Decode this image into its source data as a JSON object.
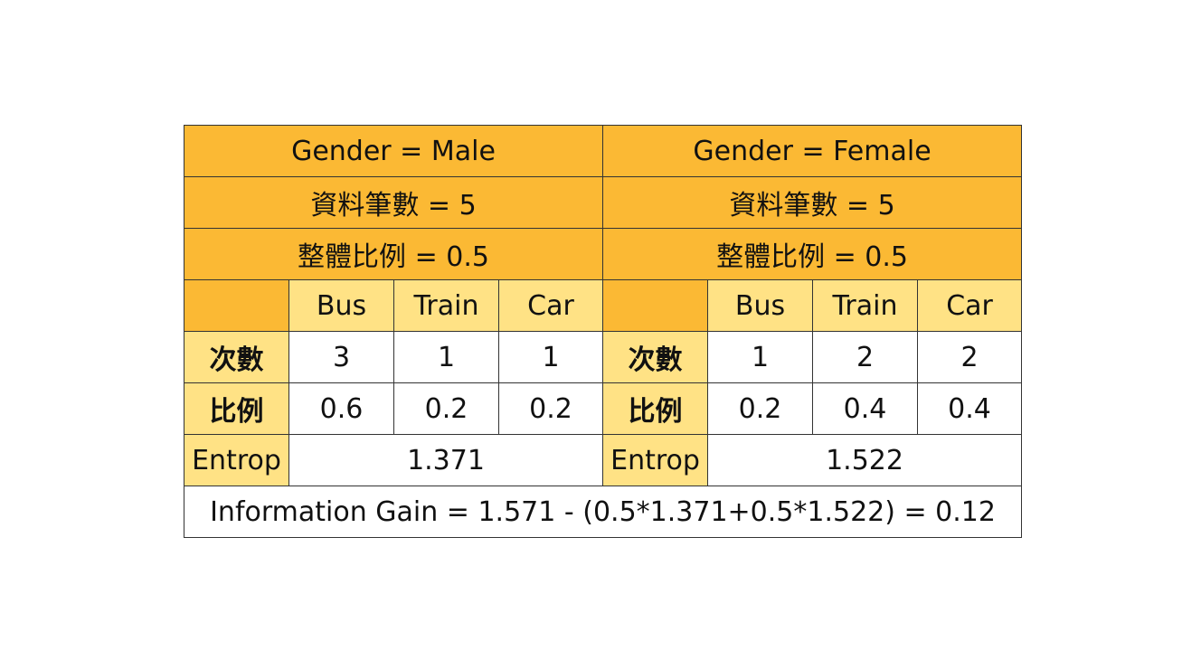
{
  "male": {
    "header": "Gender = Male",
    "count_row": "資料筆數 = 5",
    "ratio_row": "整體比例 = 0.5",
    "cols": [
      "Bus",
      "Train",
      "Car"
    ],
    "count_label": "次數",
    "counts": [
      "3",
      "1",
      "1"
    ],
    "ratio_label": "比例",
    "ratios": [
      "0.6",
      "0.2",
      "0.2"
    ],
    "entropy_label": "Entrop",
    "entropy": "1.371"
  },
  "female": {
    "header": "Gender = Female",
    "count_row": "資料筆數 = 5",
    "ratio_row": "整體比例 = 0.5",
    "cols": [
      "Bus",
      "Train",
      "Car"
    ],
    "count_label": "次數",
    "counts": [
      "1",
      "2",
      "2"
    ],
    "ratio_label": "比例",
    "ratios": [
      "0.2",
      "0.4",
      "0.4"
    ],
    "entropy_label": "Entrop",
    "entropy": "1.522"
  },
  "information_gain": "Information Gain = 1.571 - (0.5*1.371+0.5*1.522) = 0.12",
  "colors": {
    "header_bg": "#fbb934",
    "subheader_bg": "#ffe285",
    "cell_bg": "#ffffff",
    "border": "#333333"
  }
}
